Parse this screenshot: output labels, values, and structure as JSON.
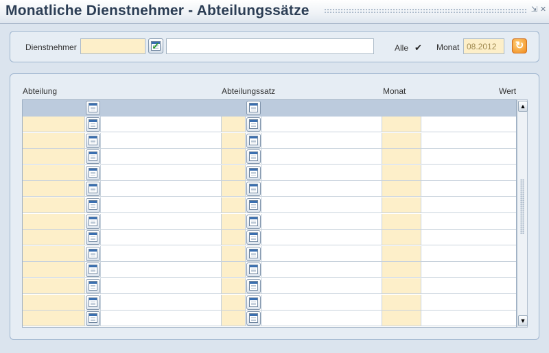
{
  "window": {
    "title": "Monatliche Dienstnehmer - Abteilungssätze",
    "minimize_glyph": "⇲",
    "close_glyph": "✕"
  },
  "filter": {
    "employee_label": "Dienstnehmer",
    "employee_code": "",
    "employee_name": "",
    "all_label": "Alle",
    "all_checked": true,
    "all_check_glyph": "✔",
    "month_label": "Monat",
    "month_value": "08.2012",
    "lookup_icon": "calendar-check-icon",
    "refresh_icon": "refresh-icon",
    "refresh_glyph": "↻"
  },
  "grid": {
    "columns": [
      "Abteilung",
      "Abteilungssatz",
      "Monat",
      "Wert"
    ],
    "row_count": 13,
    "lookup_icon": "list-lookup-icon"
  },
  "scrollbar": {
    "up_glyph": "▲",
    "down_glyph": "▼"
  },
  "colors": {
    "input_highlight": "#fdefc9",
    "header_row": "#bccbdd",
    "panel_bg": "#e6edf4",
    "refresh_accent": "#f08a1c"
  }
}
